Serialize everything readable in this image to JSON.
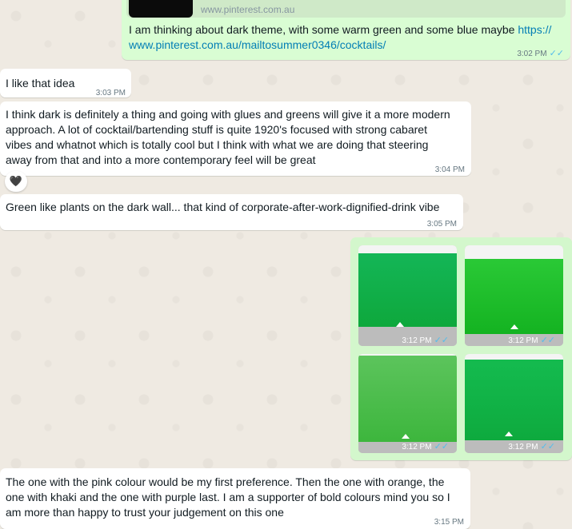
{
  "messages": [
    {
      "id": "m1",
      "direction": "outgoing",
      "link_preview_domain": "www.pinterest.com.au",
      "text": "I am thinking about dark theme, with some warm green and some blue maybe ",
      "link_part1": "https://",
      "link_part2": "www.pinterest.com.au/mailtosummer0346/cocktails/",
      "time": "3:02 PM"
    },
    {
      "id": "m2",
      "direction": "incoming",
      "text": "I like that idea",
      "time": "3:03 PM"
    },
    {
      "id": "m3",
      "direction": "incoming",
      "lines": [
        "I think dark is definitely a thing and going with glues and greens will give it a more modern",
        "approach. A lot of cocktail/bartending stuff is quite 1920's focused with strong cabaret",
        "vibes and whatnot which is totally cool but I think with what we are doing that steering",
        "away from that and into a more contemporary feel will be great"
      ],
      "time": "3:04 PM",
      "reaction": "🖤"
    },
    {
      "id": "m4",
      "direction": "incoming",
      "text": "Green like plants on the dark wall... that kind of corporate-after-work-dignified-drink vibe",
      "time": "3:05 PM"
    },
    {
      "id": "m5",
      "direction": "outgoing",
      "images": [
        {
          "time": "3:12 PM",
          "color": "#12b24c"
        },
        {
          "time": "3:12 PM",
          "color": "#22c22e"
        },
        {
          "time": "3:12 PM",
          "color": "#5ac25a"
        },
        {
          "time": "3:12 PM",
          "color": "#12b648"
        }
      ]
    },
    {
      "id": "m6",
      "direction": "incoming",
      "lines": [
        "The one with the pink colour would be my first preference. Then the one with orange, the",
        "one with khaki and the one with purple last. I am a supporter of bold colours mind you so I",
        "am more than happy to trust your judgement on this one"
      ],
      "time": "3:15 PM"
    }
  ],
  "icons": {
    "read_ticks": "✓✓"
  },
  "colors": {
    "chat_background": "#efeae2",
    "incoming_bubble": "#ffffff",
    "outgoing_bubble": "#d9fdd3",
    "link": "#027eb5",
    "read_ticks": "#53bdeb"
  }
}
